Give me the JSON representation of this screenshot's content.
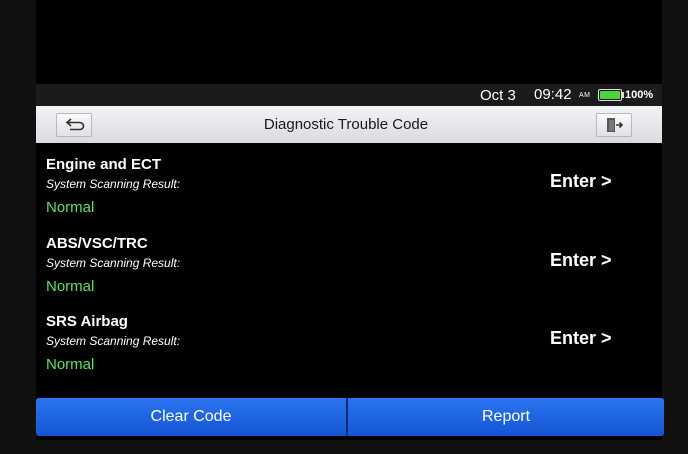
{
  "status_bar": {
    "date": "Oct 3",
    "time": "09:42",
    "ampm": "AM",
    "battery_percent_label": "100%",
    "battery_level": 1.0,
    "battery_color": "#4cd43a"
  },
  "header": {
    "title": "Diagnostic Trouble Code",
    "back_icon": "back-arrow-icon",
    "exit_icon": "exit-door-icon"
  },
  "systems": [
    {
      "name": "Engine and ECT",
      "subtitle": "System Scanning Result:",
      "status": "Normal",
      "action": "Enter >"
    },
    {
      "name": "ABS/VSC/TRC",
      "subtitle": "System Scanning Result:",
      "status": "Normal",
      "action": "Enter >"
    },
    {
      "name": "SRS Airbag",
      "subtitle": "System Scanning Result:",
      "status": "Normal",
      "action": "Enter >"
    }
  ],
  "footer": {
    "clear_label": "Clear Code",
    "report_label": "Report"
  },
  "colors": {
    "status_normal": "#5fe05f",
    "button_blue": "#1a5fe0"
  }
}
